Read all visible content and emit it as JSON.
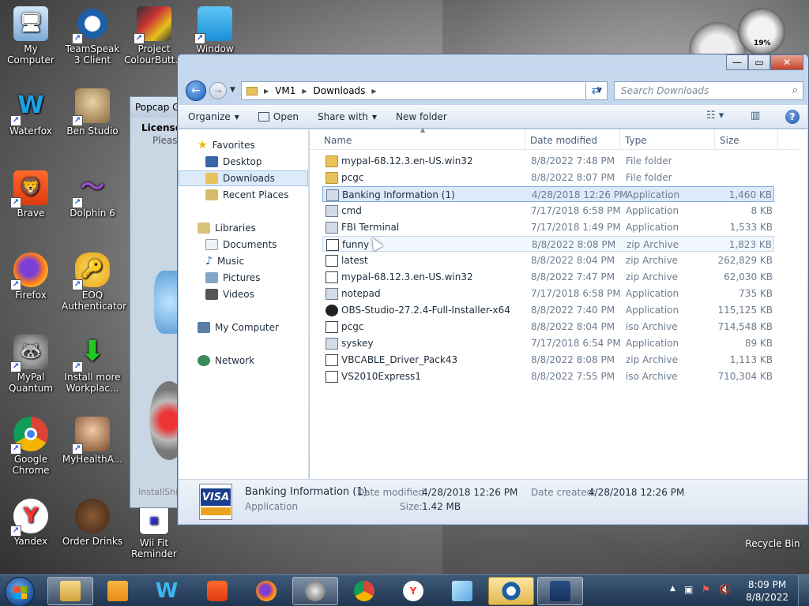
{
  "desktop": {
    "icons": [
      {
        "label": "My Computer",
        "icon": "computer-icon"
      },
      {
        "label": "TeamSpeak 3 Client",
        "icon": "teamspeak-icon"
      },
      {
        "label": "Project ColourButt...",
        "icon": "project-colourbutton-icon"
      },
      {
        "label": "Window",
        "icon": "windows-icon"
      },
      {
        "label": "Waterfox",
        "icon": "waterfox-icon"
      },
      {
        "label": "Ben Studio",
        "icon": "ben-studio-icon"
      },
      {
        "label": "Brave",
        "icon": "brave-icon"
      },
      {
        "label": "Dolphin 6",
        "icon": "dolphin-icon"
      },
      {
        "label": "Firefox",
        "icon": "firefox-icon"
      },
      {
        "label": "EOQ Authenticator",
        "icon": "eoq-authenticator-icon"
      },
      {
        "label": "MyPal Quantum",
        "icon": "mypal-icon"
      },
      {
        "label": "Install more Workplac...",
        "icon": "install-workplace-icon"
      },
      {
        "label": "Google Chrome",
        "icon": "chrome-icon"
      },
      {
        "label": "MyHealthA...",
        "icon": "myhealth-icon"
      },
      {
        "label": "Yandex",
        "icon": "yandex-icon"
      },
      {
        "label": "Order Drinks",
        "icon": "order-drinks-icon"
      },
      {
        "label": "Wii Fit Reminder",
        "icon": "wii-fit-icon"
      }
    ],
    "recycle_bin": "Recycle Bin",
    "gauge_percent": "19%"
  },
  "popcap_window": {
    "title": "Popcap Ga",
    "license": "License",
    "please": "Please",
    "install": "InstallShie"
  },
  "explorer": {
    "path": [
      "VM1",
      "Downloads"
    ],
    "search_placeholder": "Search Downloads",
    "toolbar": {
      "organize": "Organize",
      "open": "Open",
      "share_with": "Share with",
      "new_folder": "New folder"
    },
    "nav": {
      "favorites": "Favorites",
      "desktop": "Desktop",
      "downloads": "Downloads",
      "recent_places": "Recent Places",
      "libraries": "Libraries",
      "documents": "Documents",
      "music": "Music",
      "pictures": "Pictures",
      "videos": "Videos",
      "my_computer": "My Computer",
      "network": "Network"
    },
    "columns": {
      "name": "Name",
      "date": "Date modified",
      "type": "Type",
      "size": "Size"
    },
    "files": [
      {
        "name": "mypal-68.12.3.en-US.win32",
        "date": "8/8/2022 7:48 PM",
        "type": "File folder",
        "size": "",
        "icon": "folder-icon"
      },
      {
        "name": "pcgc",
        "date": "8/8/2022 8:07 PM",
        "type": "File folder",
        "size": "",
        "icon": "folder-icon"
      },
      {
        "name": "Banking Information (1)",
        "date": "4/28/2018 12:26 PM",
        "type": "Application",
        "size": "1,460 KB",
        "icon": "app-icon"
      },
      {
        "name": "cmd",
        "date": "7/17/2018 6:58 PM",
        "type": "Application",
        "size": "8 KB",
        "icon": "app-icon"
      },
      {
        "name": "FBI Terminal",
        "date": "7/17/2018 1:49 PM",
        "type": "Application",
        "size": "1,533 KB",
        "icon": "app-icon"
      },
      {
        "name": "funny",
        "date": "8/8/2022 8:08 PM",
        "type": "zip Archive",
        "size": "1,823 KB",
        "icon": "zip-icon"
      },
      {
        "name": "latest",
        "date": "8/8/2022 8:04 PM",
        "type": "zip Archive",
        "size": "262,829 KB",
        "icon": "zip-icon"
      },
      {
        "name": "mypal-68.12.3.en-US.win32",
        "date": "8/8/2022 7:47 PM",
        "type": "zip Archive",
        "size": "62,030 KB",
        "icon": "zip-icon"
      },
      {
        "name": "notepad",
        "date": "7/17/2018 6:58 PM",
        "type": "Application",
        "size": "735 KB",
        "icon": "app-icon"
      },
      {
        "name": "OBS-Studio-27.2.4-Full-Installer-x64",
        "date": "8/8/2022 7:40 PM",
        "type": "Application",
        "size": "115,125 KB",
        "icon": "obs-icon"
      },
      {
        "name": "pcgc",
        "date": "8/8/2022 8:04 PM",
        "type": "iso Archive",
        "size": "714,548 KB",
        "icon": "iso-icon"
      },
      {
        "name": "syskey",
        "date": "7/17/2018 6:54 PM",
        "type": "Application",
        "size": "89 KB",
        "icon": "app-icon"
      },
      {
        "name": "VBCABLE_Driver_Pack43",
        "date": "8/8/2022 8:08 PM",
        "type": "zip Archive",
        "size": "1,113 KB",
        "icon": "zip-icon"
      },
      {
        "name": "VS2010Express1",
        "date": "8/8/2022 7:55 PM",
        "type": "iso Archive",
        "size": "710,304 KB",
        "icon": "iso-icon"
      }
    ],
    "details": {
      "name": "Banking Information (1)",
      "type": "Application",
      "date_modified_label": "Date modified:",
      "date_modified": "4/28/2018 12:26 PM",
      "date_created_label": "Date created:",
      "date_created": "4/28/2018 12:26 PM",
      "size_label": "Size:",
      "size": "1.42 MB",
      "card_text": "VISA"
    }
  },
  "taskbar": {
    "time": "8:09 PM",
    "date": "8/8/2022"
  }
}
